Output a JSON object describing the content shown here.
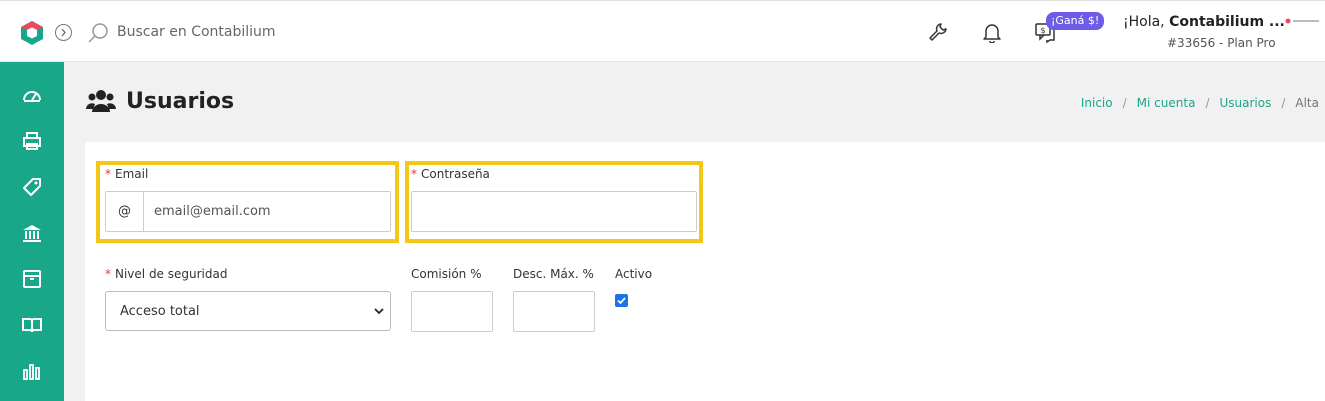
{
  "topbar": {
    "search_placeholder": "Buscar en Contabilium",
    "badge": "¡Ganá $!",
    "greeting_prefix": "¡Hola, ",
    "greeting_name": "Contabilium ...",
    "plan": "#33656 - Plan Pro",
    "icons": [
      "wrench-icon",
      "bell-icon",
      "chat-money-icon"
    ]
  },
  "sidebar": {
    "items": [
      "dashboard-icon",
      "printer-icon",
      "tag-icon",
      "bank-icon",
      "box-icon",
      "book-icon",
      "bar-chart-icon"
    ],
    "color": "#19a78a"
  },
  "page": {
    "title": "Usuarios",
    "breadcrumb": [
      "Inicio",
      "Mi cuenta",
      "Usuarios",
      "Alta"
    ]
  },
  "form": {
    "email_label": "Email",
    "email_addon": "@",
    "email_value": "email@email.com",
    "password_label": "Contraseña",
    "password_value": "",
    "security_label": "Nivel de seguridad",
    "security_value": "Acceso total",
    "commission_label": "Comisión %",
    "commission_value": "",
    "discount_label": "Desc. Máx. %",
    "discount_value": "",
    "active_label": "Activo",
    "active_checked": true,
    "required_mark": "*"
  },
  "colors": {
    "accent": "#19a78a",
    "highlight": "#f5c518",
    "badge": "#6c5ce7",
    "required": "#e53935"
  }
}
